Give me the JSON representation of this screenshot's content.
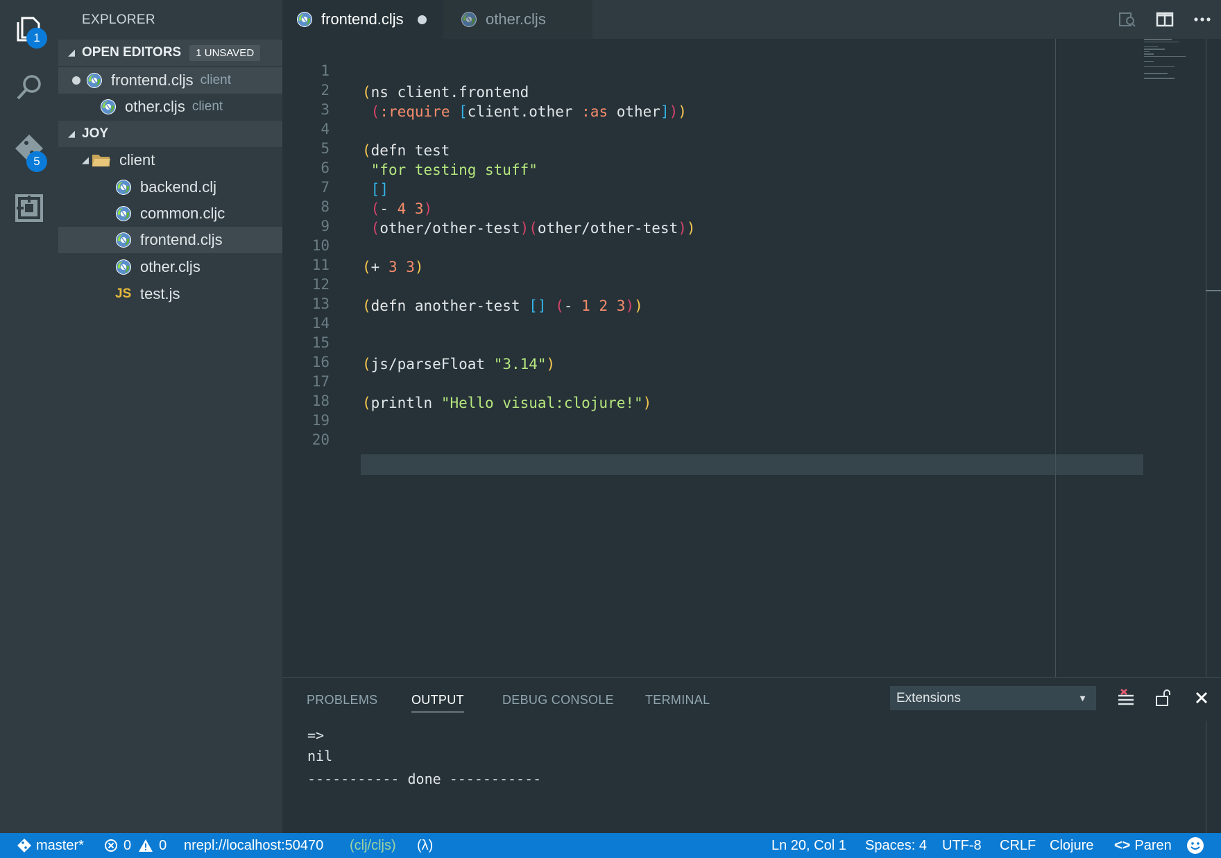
{
  "activity": {
    "explorer_badge": "1",
    "scm_badge": "5"
  },
  "sidebar": {
    "title": "EXPLORER",
    "open_editors": {
      "label": "OPEN EDITORS",
      "badge": "1 UNSAVED",
      "items": [
        {
          "name": "frontend.cljs",
          "desc": "client"
        },
        {
          "name": "other.cljs",
          "desc": "client"
        }
      ]
    },
    "project": {
      "label": "JOY",
      "folder": "client",
      "files": [
        "backend.clj",
        "common.cljc",
        "frontend.cljs",
        "other.cljs",
        "test.js"
      ],
      "js_badge": "JS"
    }
  },
  "tabs": [
    {
      "label": "frontend.cljs"
    },
    {
      "label": "other.cljs"
    }
  ],
  "editor": {
    "line_numbers": [
      "1",
      "2",
      "3",
      "4",
      "5",
      "6",
      "7",
      "8",
      "9",
      "10",
      "11",
      "12",
      "13",
      "14",
      "15",
      "16",
      "17",
      "18",
      "19",
      "20"
    ],
    "code": {
      "l1": [
        "(",
        "ns",
        " client.frontend"
      ],
      "l2": [
        "(",
        ":require",
        " ",
        "[",
        "client.other",
        " ",
        ":as",
        " other",
        "]",
        ")",
        ")"
      ],
      "l4": [
        "(",
        "defn",
        " test"
      ],
      "l5": [
        "\"for testing stuff\""
      ],
      "l6": [
        "[",
        "]"
      ],
      "l7": [
        "(",
        "- ",
        "4",
        " ",
        "3",
        ")"
      ],
      "l8": [
        "(",
        "other/other-test",
        ")",
        "(",
        "other/other-test",
        ")",
        ")"
      ],
      "l10": [
        "(",
        "+ ",
        "3",
        " ",
        "3",
        ")"
      ],
      "l12": [
        "(",
        "defn",
        " another-test ",
        "[",
        "]",
        " ",
        "(",
        "- ",
        "1",
        " ",
        "2",
        " ",
        "3",
        ")",
        ")"
      ],
      "l15": [
        "(",
        "js/parseFloat",
        " ",
        "\"3.14\"",
        ")"
      ],
      "l17": [
        "(",
        "println",
        " ",
        "\"Hello visual:clojure!\"",
        ")"
      ]
    }
  },
  "panel": {
    "tabs": [
      "PROBLEMS",
      "OUTPUT",
      "DEBUG CONSOLE",
      "TERMINAL"
    ],
    "select_value": "Extensions",
    "output_lines": [
      "=>",
      "nil",
      "----------- done -----------"
    ]
  },
  "status": {
    "branch": "master*",
    "errors": "0",
    "warnings": "0",
    "nrepl": "nrepl://localhost:50470",
    "mode": "(clj/cljs)",
    "lambda": "(λ)",
    "position": "Ln 20, Col 1",
    "spaces": "Spaces: 4",
    "encoding": "UTF-8",
    "eol": "CRLF",
    "language": "Clojure",
    "paren": "Paren"
  },
  "colors": {
    "accent": "#0c7bd3",
    "editor_bg": "#263238",
    "sidebar_bg": "#303c42"
  }
}
